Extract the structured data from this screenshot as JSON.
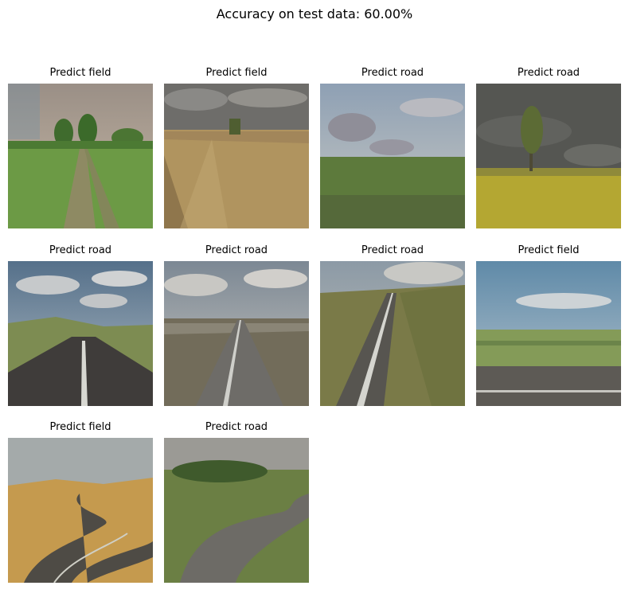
{
  "figure": {
    "title": "Accuracy on test data: 60.00%",
    "images": [
      {
        "caption": "Predict field",
        "scene": "dirt-track-meadow"
      },
      {
        "caption": "Predict field",
        "scene": "wheat-harvest"
      },
      {
        "caption": "Predict road",
        "scene": "green-field-sky"
      },
      {
        "caption": "Predict road",
        "scene": "rapeseed-tree"
      },
      {
        "caption": "Predict road",
        "scene": "country-road-hills"
      },
      {
        "caption": "Predict road",
        "scene": "crossroad-marked"
      },
      {
        "caption": "Predict road",
        "scene": "curving-road-hill"
      },
      {
        "caption": "Predict field",
        "scene": "roadside-plain"
      },
      {
        "caption": "Predict field",
        "scene": "desert-road"
      },
      {
        "caption": "Predict road",
        "scene": "winding-road-forest"
      }
    ]
  }
}
